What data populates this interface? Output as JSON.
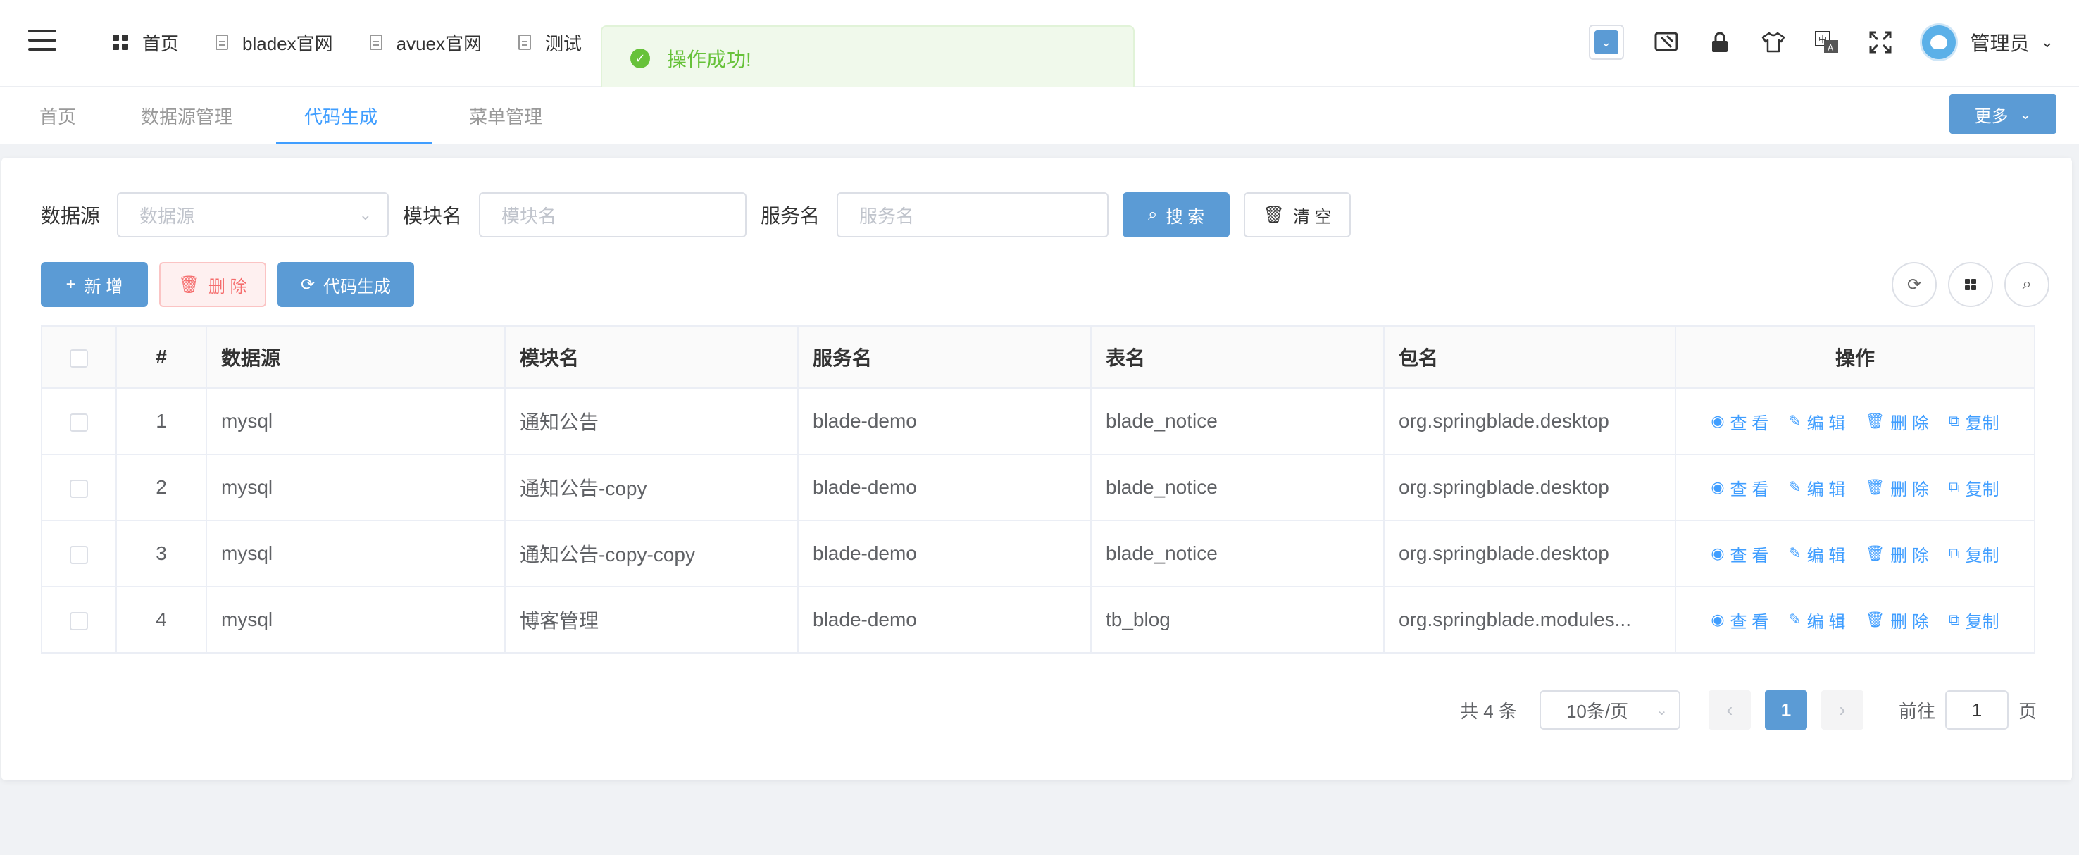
{
  "topbar": {
    "menu": [
      {
        "label": "首页",
        "icon": "grid-icon"
      },
      {
        "label": "bladex官网",
        "icon": "document-icon"
      },
      {
        "label": "avuex官网",
        "icon": "document-icon"
      },
      {
        "label": "测试",
        "icon": "document-icon"
      }
    ],
    "user_name": "管理员"
  },
  "toast": {
    "message": "操作成功!",
    "type": "success",
    "color": "#67c23a"
  },
  "tabs": {
    "items": [
      {
        "label": "首页",
        "active": false
      },
      {
        "label": "数据源管理",
        "active": false
      },
      {
        "label": "代码生成",
        "active": true,
        "closable": true
      },
      {
        "label": "菜单管理",
        "active": false
      }
    ],
    "more_label": "更多"
  },
  "search": {
    "datasource_label": "数据源",
    "datasource_placeholder": "数据源",
    "module_label": "模块名",
    "module_placeholder": "模块名",
    "service_label": "服务名",
    "service_placeholder": "服务名",
    "search_button": "搜 索",
    "clear_button": "清 空"
  },
  "actions": {
    "add": "新 增",
    "delete": "删 除",
    "generate": "代码生成"
  },
  "table": {
    "columns": [
      "#",
      "数据源",
      "模块名",
      "服务名",
      "表名",
      "包名",
      "操作"
    ],
    "rows": [
      {
        "index": "1",
        "datasource": "mysql",
        "module": "通知公告",
        "service": "blade-demo",
        "table": "blade_notice",
        "package": "org.springblade.desktop"
      },
      {
        "index": "2",
        "datasource": "mysql",
        "module": "通知公告-copy",
        "service": "blade-demo",
        "table": "blade_notice",
        "package": "org.springblade.desktop"
      },
      {
        "index": "3",
        "datasource": "mysql",
        "module": "通知公告-copy-copy",
        "service": "blade-demo",
        "table": "blade_notice",
        "package": "org.springblade.desktop"
      },
      {
        "index": "4",
        "datasource": "mysql",
        "module": "博客管理",
        "service": "blade-demo",
        "table": "tb_blog",
        "package": "org.springblade.modules..."
      }
    ],
    "ops": {
      "view": "查 看",
      "edit": "编 辑",
      "delete": "删 除",
      "copy": "复制"
    }
  },
  "pagination": {
    "total_text": "共 4 条",
    "page_size": "10条/页",
    "current_page": "1",
    "goto_prefix": "前往",
    "goto_value": "1",
    "goto_suffix": "页"
  },
  "colors": {
    "primary": "#5b9bd5",
    "link": "#409eff",
    "success": "#67c23a",
    "danger": "#f56c6c"
  }
}
